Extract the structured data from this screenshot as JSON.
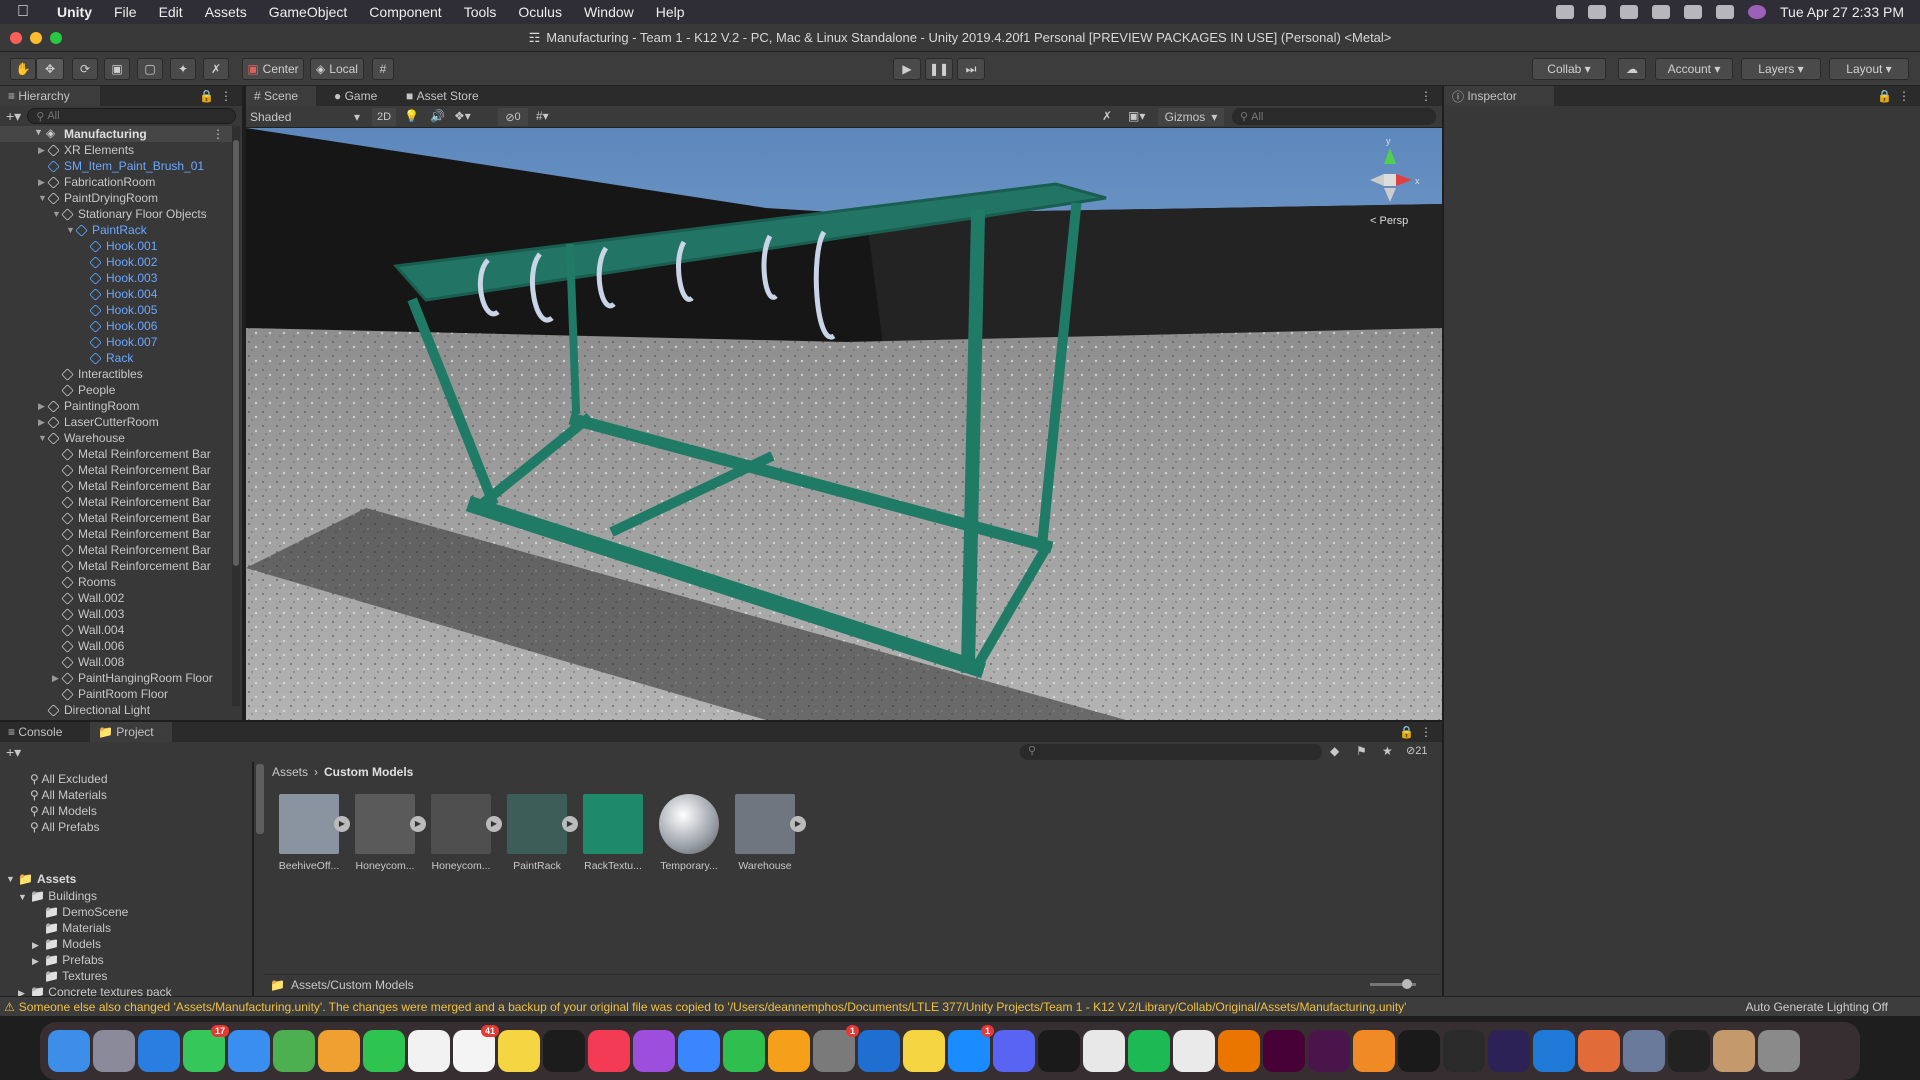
{
  "menubar": {
    "app": "Unity",
    "items": [
      "File",
      "Edit",
      "Assets",
      "GameObject",
      "Component",
      "Tools",
      "Oculus",
      "Window",
      "Help"
    ],
    "datetime": "Tue Apr 27  2:33 PM"
  },
  "window_title": "Manufacturing - Team 1 - K12 V.2 - PC, Mac & Linux Standalone - Unity 2019.4.20f1 Personal [PREVIEW PACKAGES IN USE] (Personal) <Metal>",
  "toolbar": {
    "pivot": "Center",
    "space": "Local",
    "collab": "Collab",
    "account": "Account",
    "layers": "Layers",
    "layout": "Layout"
  },
  "hierarchy": {
    "tab": "Hierarchy",
    "search_placeholder": "All",
    "scene": "Manufacturing",
    "rows": [
      {
        "label": "XR Elements",
        "depth": 1,
        "arrow": "▶",
        "blue": false
      },
      {
        "label": "SM_Item_Paint_Brush_01",
        "depth": 1,
        "arrow": "",
        "blue": true
      },
      {
        "label": "FabricationRoom",
        "depth": 1,
        "arrow": "▶",
        "blue": false
      },
      {
        "label": "PaintDryingRoom",
        "depth": 1,
        "arrow": "▼",
        "blue": false
      },
      {
        "label": "Stationary Floor Objects",
        "depth": 2,
        "arrow": "▼",
        "blue": false
      },
      {
        "label": "PaintRack",
        "depth": 3,
        "arrow": "▼",
        "blue": true
      },
      {
        "label": "Hook.001",
        "depth": 4,
        "arrow": "",
        "blue": true
      },
      {
        "label": "Hook.002",
        "depth": 4,
        "arrow": "",
        "blue": true
      },
      {
        "label": "Hook.003",
        "depth": 4,
        "arrow": "",
        "blue": true
      },
      {
        "label": "Hook.004",
        "depth": 4,
        "arrow": "",
        "blue": true
      },
      {
        "label": "Hook.005",
        "depth": 4,
        "arrow": "",
        "blue": true
      },
      {
        "label": "Hook.006",
        "depth": 4,
        "arrow": "",
        "blue": true
      },
      {
        "label": "Hook.007",
        "depth": 4,
        "arrow": "",
        "blue": true
      },
      {
        "label": "Rack",
        "depth": 4,
        "arrow": "",
        "blue": true
      },
      {
        "label": "Interactibles",
        "depth": 2,
        "arrow": "",
        "blue": false
      },
      {
        "label": "People",
        "depth": 2,
        "arrow": "",
        "blue": false
      },
      {
        "label": "PaintingRoom",
        "depth": 1,
        "arrow": "▶",
        "blue": false
      },
      {
        "label": "LaserCutterRoom",
        "depth": 1,
        "arrow": "▶",
        "blue": false
      },
      {
        "label": "Warehouse",
        "depth": 1,
        "arrow": "▼",
        "blue": false
      },
      {
        "label": "Metal Reinforcement Bar",
        "depth": 2,
        "arrow": "",
        "blue": false
      },
      {
        "label": "Metal Reinforcement Bar",
        "depth": 2,
        "arrow": "",
        "blue": false
      },
      {
        "label": "Metal Reinforcement Bar",
        "depth": 2,
        "arrow": "",
        "blue": false
      },
      {
        "label": "Metal Reinforcement Bar",
        "depth": 2,
        "arrow": "",
        "blue": false
      },
      {
        "label": "Metal Reinforcement Bar",
        "depth": 2,
        "arrow": "",
        "blue": false
      },
      {
        "label": "Metal Reinforcement Bar",
        "depth": 2,
        "arrow": "",
        "blue": false
      },
      {
        "label": "Metal Reinforcement Bar",
        "depth": 2,
        "arrow": "",
        "blue": false
      },
      {
        "label": "Metal Reinforcement Bar",
        "depth": 2,
        "arrow": "",
        "blue": false
      },
      {
        "label": "Rooms",
        "depth": 2,
        "arrow": "",
        "blue": false
      },
      {
        "label": "Wall.002",
        "depth": 2,
        "arrow": "",
        "blue": false
      },
      {
        "label": "Wall.003",
        "depth": 2,
        "arrow": "",
        "blue": false
      },
      {
        "label": "Wall.004",
        "depth": 2,
        "arrow": "",
        "blue": false
      },
      {
        "label": "Wall.006",
        "depth": 2,
        "arrow": "",
        "blue": false
      },
      {
        "label": "Wall.008",
        "depth": 2,
        "arrow": "",
        "blue": false
      },
      {
        "label": "PaintHangingRoom Floor",
        "depth": 2,
        "arrow": "▶",
        "blue": false
      },
      {
        "label": "PaintRoom Floor",
        "depth": 2,
        "arrow": "",
        "blue": false
      },
      {
        "label": "Directional Light",
        "depth": 1,
        "arrow": "",
        "blue": false
      }
    ]
  },
  "scene_view": {
    "tabs": [
      "Scene",
      "Game",
      "Asset Store"
    ],
    "shading": "Shaded",
    "mode_2d": "2D",
    "hidden_count": "0",
    "gizmos": "Gizmos",
    "search_placeholder": "All",
    "persp_label": "< Persp",
    "axis_x": "x",
    "axis_y": "y"
  },
  "inspector": {
    "tab": "Inspector"
  },
  "console_tab": "Console",
  "project": {
    "tab": "Project",
    "hidden_count": "21",
    "favorites": [
      "All Excluded",
      "All Materials",
      "All Models",
      "All Prefabs"
    ],
    "root": "Assets",
    "tree": [
      {
        "label": "Buildings",
        "depth": 1,
        "arrow": "▼"
      },
      {
        "label": "DemoScene",
        "depth": 2,
        "arrow": ""
      },
      {
        "label": "Materials",
        "depth": 2,
        "arrow": ""
      },
      {
        "label": "Models",
        "depth": 2,
        "arrow": "▶"
      },
      {
        "label": "Prefabs",
        "depth": 2,
        "arrow": "▶"
      },
      {
        "label": "Textures",
        "depth": 2,
        "arrow": ""
      },
      {
        "label": "Concrete textures pack",
        "depth": 1,
        "arrow": "▶"
      },
      {
        "label": "Custom Models",
        "depth": 1,
        "arrow": ""
      }
    ],
    "breadcrumb_root": "Assets",
    "breadcrumb_current": "Custom Models",
    "assets": [
      {
        "label": "BeehiveOff...",
        "color": "#8a94a0",
        "play": true
      },
      {
        "label": "Honeycom...",
        "color": "#5a5a5a",
        "play": true
      },
      {
        "label": "Honeycom...",
        "color": "#4f4f4f",
        "play": true
      },
      {
        "label": "PaintRack",
        "color": "#3d5d58",
        "play": true
      },
      {
        "label": "RackTextu...",
        "color": "#1e8a6a",
        "play": false
      },
      {
        "label": "Temporary...",
        "color": "#b9bec4",
        "play": false
      },
      {
        "label": "Warehouse",
        "color": "#6f7680",
        "play": true
      }
    ],
    "footer_path": "Assets/Custom Models"
  },
  "status": {
    "message": "Someone else also changed 'Assets/Manufacturing.unity'. The changes were merged and a backup of your original file was copied to '/Users/deannemphos/Documents/LTLE 377/Unity Projects/Team 1 - K12 V.2/Library/Collab/Original/Assets/Manufacturing.unity'",
    "right": "Auto Generate Lighting Off"
  },
  "dock": [
    {
      "name": "finder-icon",
      "color": "#3d8ee8",
      "badge": ""
    },
    {
      "name": "launchpad-icon",
      "color": "#8a8a9a",
      "badge": ""
    },
    {
      "name": "safari-icon",
      "color": "#2a7de1",
      "badge": ""
    },
    {
      "name": "messages-icon",
      "color": "#35c759",
      "badge": "17"
    },
    {
      "name": "mail-icon",
      "color": "#3a8ef0",
      "badge": ""
    },
    {
      "name": "maps-icon",
      "color": "#4caf50",
      "badge": ""
    },
    {
      "name": "photos-icon",
      "color": "#f0a030",
      "badge": ""
    },
    {
      "name": "facetime-icon",
      "color": "#2ec450",
      "badge": ""
    },
    {
      "name": "calendar-icon",
      "color": "#f2f2f2",
      "badge": ""
    },
    {
      "name": "reminders-icon",
      "color": "#f4f4f4",
      "badge": "41"
    },
    {
      "name": "notes-icon",
      "color": "#f5d542",
      "badge": ""
    },
    {
      "name": "news-icon",
      "color": "#1c1c1c",
      "badge": ""
    },
    {
      "name": "music-icon",
      "color": "#f43b56",
      "badge": ""
    },
    {
      "name": "podcasts-icon",
      "color": "#9d4edd",
      "badge": ""
    },
    {
      "name": "keynote-icon",
      "color": "#3a86ff",
      "badge": ""
    },
    {
      "name": "numbers-icon",
      "color": "#2fbf4f",
      "badge": ""
    },
    {
      "name": "pages-icon",
      "color": "#f59f1b",
      "badge": ""
    },
    {
      "name": "system-preferences-icon",
      "color": "#7a7a7a",
      "badge": "1"
    },
    {
      "name": "xcode-icon",
      "color": "#1f6fd0",
      "badge": ""
    },
    {
      "name": "stickies-icon",
      "color": "#f5d542",
      "badge": ""
    },
    {
      "name": "app-store-icon",
      "color": "#1a8cff",
      "badge": "1"
    },
    {
      "name": "discord-icon",
      "color": "#5865f2",
      "badge": ""
    },
    {
      "name": "terminal-icon",
      "color": "#1a1a1a",
      "badge": ""
    },
    {
      "name": "chrome-icon",
      "color": "#e8e8e8",
      "badge": ""
    },
    {
      "name": "spotify-icon",
      "color": "#1db954",
      "badge": ""
    },
    {
      "name": "unity-hub-icon",
      "color": "#eaeaea",
      "badge": ""
    },
    {
      "name": "blender-icon",
      "color": "#ea7600",
      "badge": ""
    },
    {
      "name": "xd-icon",
      "color": "#470137",
      "badge": ""
    },
    {
      "name": "slack-icon",
      "color": "#4a154b",
      "badge": ""
    },
    {
      "name": "books-icon",
      "color": "#f08a24",
      "badge": ""
    },
    {
      "name": "intellij-icon",
      "color": "#1a1a1a",
      "badge": ""
    },
    {
      "name": "github-icon",
      "color": "#2a2a2a",
      "badge": ""
    },
    {
      "name": "eclipse-icon",
      "color": "#2c2255",
      "badge": ""
    },
    {
      "name": "vscode-icon",
      "color": "#1e7ad6",
      "badge": ""
    },
    {
      "name": "preview-icon",
      "color": "#e26b3a",
      "badge": ""
    },
    {
      "name": "xcode-tools-icon",
      "color": "#6a7a9a",
      "badge": ""
    },
    {
      "name": "unity-icon",
      "color": "#222",
      "badge": ""
    },
    {
      "name": "archive-icon",
      "color": "#c49a6c",
      "badge": ""
    },
    {
      "name": "trash-icon",
      "color": "#8a8a8a",
      "badge": ""
    }
  ],
  "colors": {
    "accent": "#3a7bd5",
    "rack": "#1f7a66",
    "warning": "#f0c040"
  }
}
